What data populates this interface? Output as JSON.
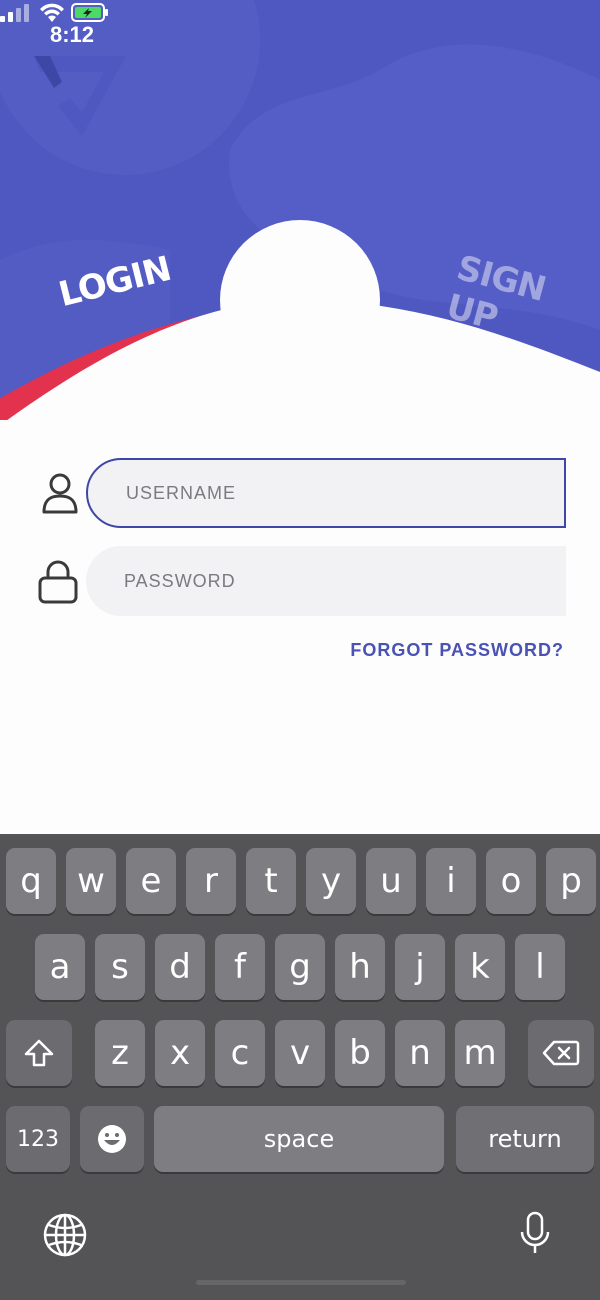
{
  "status_bar": {
    "time": "8:12",
    "icons": [
      "cellular-signal-icon",
      "wifi-icon",
      "battery-charging-icon"
    ]
  },
  "tabs": {
    "login": "LOGIN",
    "signup": "SIGN UP"
  },
  "form": {
    "username": {
      "placeholder": "USERNAME",
      "value": "",
      "icon": "user-icon"
    },
    "password": {
      "placeholder": "PASSWORD",
      "value": "",
      "icon": "lock-icon"
    },
    "forgot_password": "FORGOT PASSWORD?"
  },
  "keyboard": {
    "row1": [
      "q",
      "w",
      "e",
      "r",
      "t",
      "y",
      "u",
      "i",
      "o",
      "p"
    ],
    "row2": [
      "a",
      "s",
      "d",
      "f",
      "g",
      "h",
      "j",
      "k",
      "l"
    ],
    "row3": [
      "z",
      "x",
      "c",
      "v",
      "b",
      "n",
      "m"
    ],
    "numbers_label": "123",
    "space_label": "space",
    "return_label": "return",
    "icons": [
      "shift-icon",
      "backspace-icon",
      "emoji-icon",
      "globe-icon",
      "microphone-icon"
    ]
  },
  "colors": {
    "brand_blue": "#4f58c0",
    "accent_red": "#e3324d",
    "input_border": "#3f47a6",
    "link": "#4a52b4",
    "keyboard_bg": "#545456",
    "key_bg": "#7e7d82"
  }
}
